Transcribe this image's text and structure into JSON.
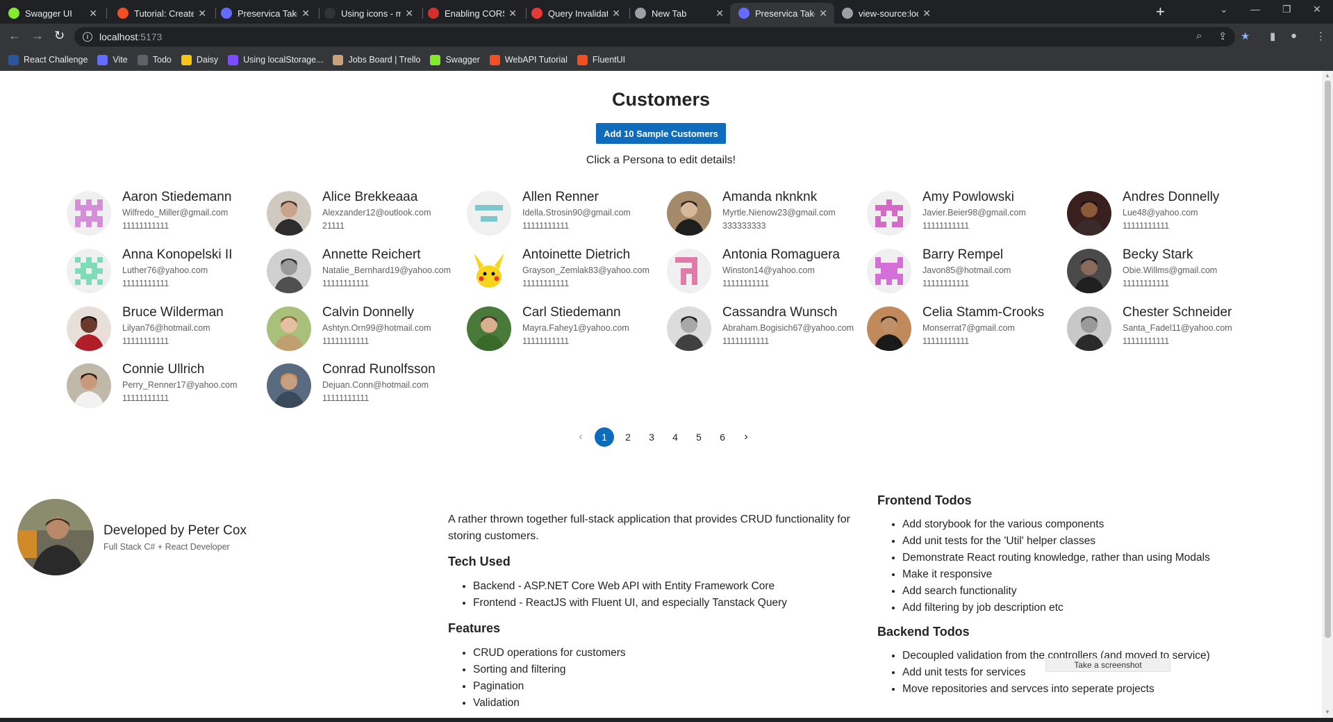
{
  "browser": {
    "tabs": [
      {
        "title": "Swagger UI",
        "icon": "swagger-icon",
        "color": "#85ea2d"
      },
      {
        "title": "Tutorial: Create a web",
        "icon": "microsoft-icon",
        "color": "#f25022"
      },
      {
        "title": "Preservica Takehome T",
        "icon": "vite-icon",
        "color": "#646cff"
      },
      {
        "title": "Using icons - microsof",
        "icon": "github-icon",
        "color": "#333333"
      },
      {
        "title": "Enabling CORS in ASP.",
        "icon": "diamond-icon",
        "color": "#d32f2f"
      },
      {
        "title": "Query Invalidation | Ta",
        "icon": "tanstack-icon",
        "color": "#e53935"
      },
      {
        "title": "New Tab",
        "icon": "chrome-icon",
        "color": "#9aa0a6"
      },
      {
        "title": "Preservica Takehome T",
        "icon": "vite-icon",
        "color": "#646cff"
      },
      {
        "title": "view-source:localhost:",
        "icon": "globe-icon",
        "color": "#9aa0a6"
      }
    ],
    "url_host": "localhost",
    "url_port": ":5173",
    "bookmarks": [
      {
        "label": "React Challenge",
        "icon": "word-icon",
        "color": "#2b579a"
      },
      {
        "label": "Vite",
        "icon": "vite-icon",
        "color": "#646cff"
      },
      {
        "label": "Todo",
        "icon": "globe-icon",
        "color": "#5f6368"
      },
      {
        "label": "Daisy",
        "icon": "daisy-icon",
        "color": "#f5c518"
      },
      {
        "label": "Using localStorage...",
        "icon": "storage-icon",
        "color": "#7c4dff"
      },
      {
        "label": "Jobs Board | Trello",
        "icon": "trello-icon",
        "color": "#c8a27a"
      },
      {
        "label": "Swagger",
        "icon": "swagger-icon",
        "color": "#85ea2d"
      },
      {
        "label": "WebAPI Tutorial",
        "icon": "microsoft-icon",
        "color": "#f25022"
      },
      {
        "label": "FluentUI",
        "icon": "microsoft-icon",
        "color": "#f25022"
      }
    ]
  },
  "page": {
    "title": "Customers",
    "add_button": "Add 10 Sample Customers",
    "hint": "Click a Persona to edit details!",
    "accent": "#0f6cbd"
  },
  "customers": [
    {
      "name": "Aaron Stiedemann",
      "email": "Wilfredo_Miller@gmail.com",
      "phone": "11111111111",
      "avatar": "identicon-pink-icon"
    },
    {
      "name": "Alice Brekkeaaa",
      "email": "Alexzander12@outlook.com",
      "phone": "21111",
      "avatar": "photo-avatar"
    },
    {
      "name": "Allen Renner",
      "email": "Idella.Strosin90@gmail.com",
      "phone": "11111111111",
      "avatar": "identicon-teal-icon"
    },
    {
      "name": "Amanda nknknk",
      "email": "Myrtle.Nienow23@gmail.com",
      "phone": "333333333",
      "avatar": "photo-avatar"
    },
    {
      "name": "Amy Powlowski",
      "email": "Javier.Beier98@gmail.com",
      "phone": "11111111111",
      "avatar": "identicon-magenta-icon"
    },
    {
      "name": "Andres Donnelly",
      "email": "Lue48@yahoo.com",
      "phone": "11111111111",
      "avatar": "photo-avatar"
    },
    {
      "name": "Anna Konopelski II",
      "email": "Luther76@yahoo.com",
      "phone": "11111111111",
      "avatar": "identicon-mint-icon"
    },
    {
      "name": "Annette Reichert",
      "email": "Natalie_Bernhard19@yahoo.com",
      "phone": "11111111111",
      "avatar": "photo-avatar"
    },
    {
      "name": "Antoinette Dietrich",
      "email": "Grayson_Zemlak83@yahoo.com",
      "phone": "11111111111",
      "avatar": "pikachu-avatar"
    },
    {
      "name": "Antonia Romaguera",
      "email": "Winston14@yahoo.com",
      "phone": "11111111111",
      "avatar": "identicon-rose-icon"
    },
    {
      "name": "Barry Rempel",
      "email": "Javon85@hotmail.com",
      "phone": "11111111111",
      "avatar": "identicon-orchid-icon"
    },
    {
      "name": "Becky Stark",
      "email": "Obie.Willms@gmail.com",
      "phone": "11111111111",
      "avatar": "photo-avatar"
    },
    {
      "name": "Bruce Wilderman",
      "email": "Lilyan76@hotmail.com",
      "phone": "11111111111",
      "avatar": "photo-avatar"
    },
    {
      "name": "Calvin Donnelly",
      "email": "Ashtyn.Orn99@hotmail.com",
      "phone": "11111111111",
      "avatar": "photo-avatar"
    },
    {
      "name": "Carl Stiedemann",
      "email": "Mayra.Fahey1@yahoo.com",
      "phone": "11111111111",
      "avatar": "photo-avatar"
    },
    {
      "name": "Cassandra Wunsch",
      "email": "Abraham.Bogisich67@yahoo.com",
      "phone": "11111111111",
      "avatar": "photo-avatar"
    },
    {
      "name": "Celia Stamm-Crooks",
      "email": "Monserrat7@gmail.com",
      "phone": "11111111111",
      "avatar": "photo-avatar"
    },
    {
      "name": "Chester Schneider",
      "email": "Santa_Fadel11@yahoo.com",
      "phone": "11111111111",
      "avatar": "photo-avatar"
    },
    {
      "name": "Connie Ullrich",
      "email": "Perry_Renner17@yahoo.com",
      "phone": "11111111111",
      "avatar": "photo-avatar"
    },
    {
      "name": "Conrad Runolfsson",
      "email": "Dejuan.Conn@hotmail.com",
      "phone": "11111111111",
      "avatar": "photo-avatar"
    }
  ],
  "pagination": {
    "prev": "‹",
    "next": "›",
    "pages": [
      "1",
      "2",
      "3",
      "4",
      "5",
      "6"
    ],
    "current": "1"
  },
  "developer": {
    "name": "Developed by Peter Cox",
    "role": "Full Stack C# + React Developer"
  },
  "about": {
    "description": "A rather thrown together full-stack application that provides CRUD functionality for storing customers.",
    "tech_heading": "Tech Used",
    "tech": [
      "Backend - ASP.NET Core Web API with Entity Framework Core",
      "Frontend - ReactJS with Fluent UI, and especially Tanstack Query"
    ],
    "features_heading": "Features",
    "features": [
      "CRUD operations for customers",
      "Sorting and filtering",
      "Pagination",
      "Validation"
    ]
  },
  "todos": {
    "frontend_heading": "Frontend Todos",
    "frontend": [
      "Add storybook for the various components",
      "Add unit tests for the 'Util' helper classes",
      "Demonstrate React routing knowledge, rather than using Modals",
      "Make it responsive",
      "Add search functionality",
      "Add filtering by job description etc"
    ],
    "backend_heading": "Backend Todos",
    "backend": [
      "Decoupled validation from the controllers (and moved to service)",
      "Add unit tests for services",
      "Move repositories and servces into seperate projects"
    ]
  },
  "screenshot_tooltip": "Take a screenshot"
}
